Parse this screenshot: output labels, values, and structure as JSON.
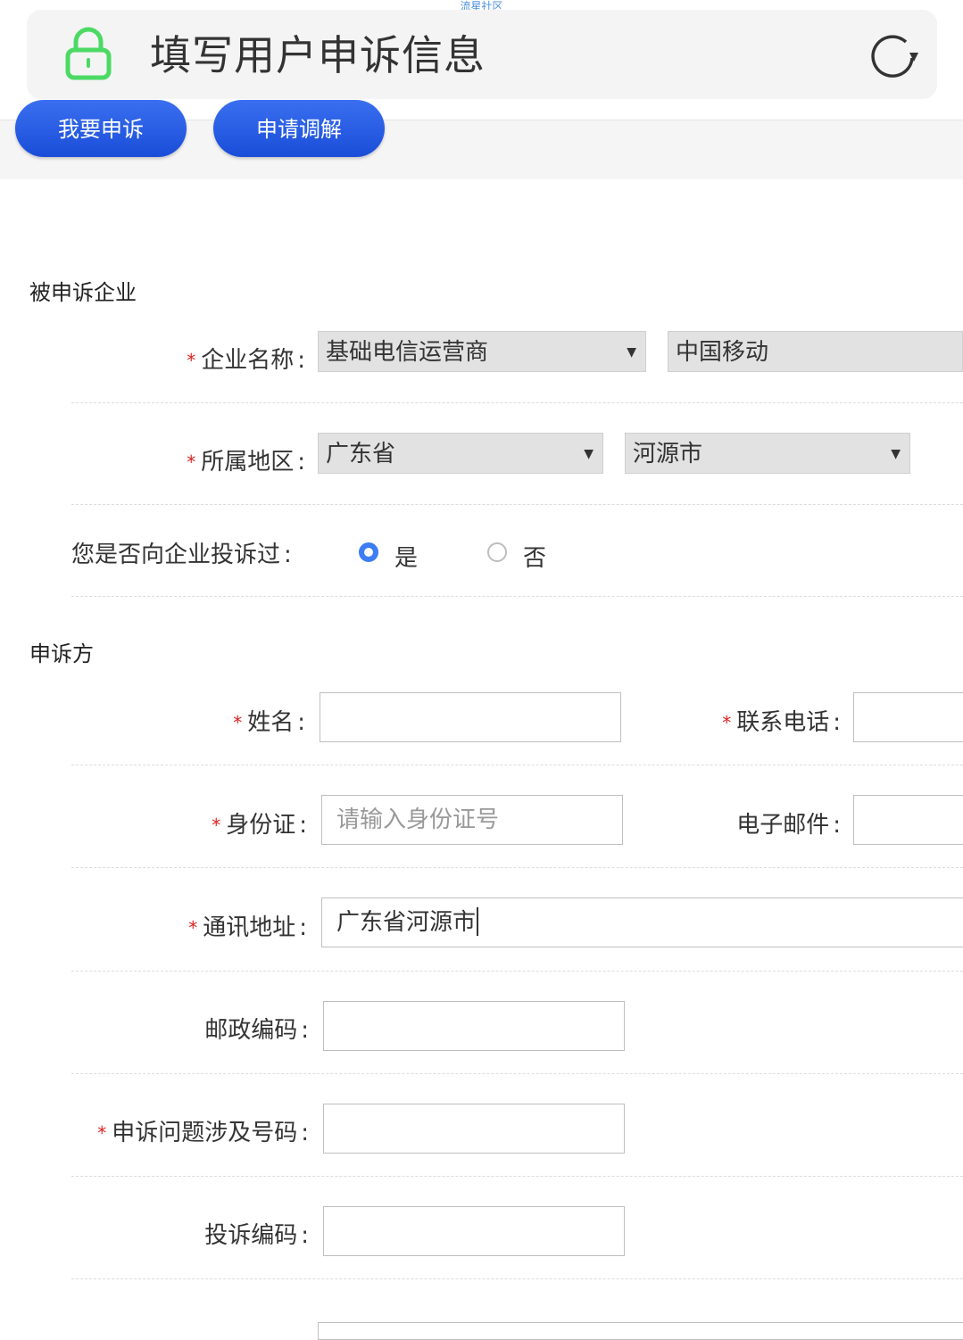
{
  "watermark": "流星社区",
  "header": {
    "title": "填写用户申诉信息",
    "lock_icon": "lock-icon",
    "refresh_icon": "refresh-icon",
    "accent": "#4cd964"
  },
  "tabs": [
    {
      "label": "我要申诉"
    },
    {
      "label": "申请调解"
    }
  ],
  "section_enterprise": {
    "title": "被申诉企业",
    "company_label": "企业名称",
    "company_type": "基础电信运营商",
    "company_name": "中国移动",
    "region_label": "所属地区",
    "province": "广东省",
    "city": "河源市",
    "complained_label": "您是否向企业投诉过",
    "yes": "是",
    "no": "否",
    "complained_selected": "是"
  },
  "section_complainant": {
    "title": "申诉方",
    "name_label": "姓名",
    "name_value": "",
    "phone_label": "联系电话",
    "phone_value": "",
    "id_label": "身份证",
    "id_placeholder": "请输入身份证号",
    "email_label": "电子邮件",
    "email_value": "",
    "address_label": "通讯地址",
    "address_value": "广东省河源市",
    "postcode_label": "邮政编码",
    "postcode_value": "",
    "number_label": "申诉问题涉及号码",
    "number_value": "",
    "complaint_code_label": "投诉编码",
    "complaint_code_value": ""
  },
  "required_mark": "*",
  "colors": {
    "button": "#1a4dd8",
    "required": "#e02020",
    "radio_on": "#3d7df5"
  }
}
